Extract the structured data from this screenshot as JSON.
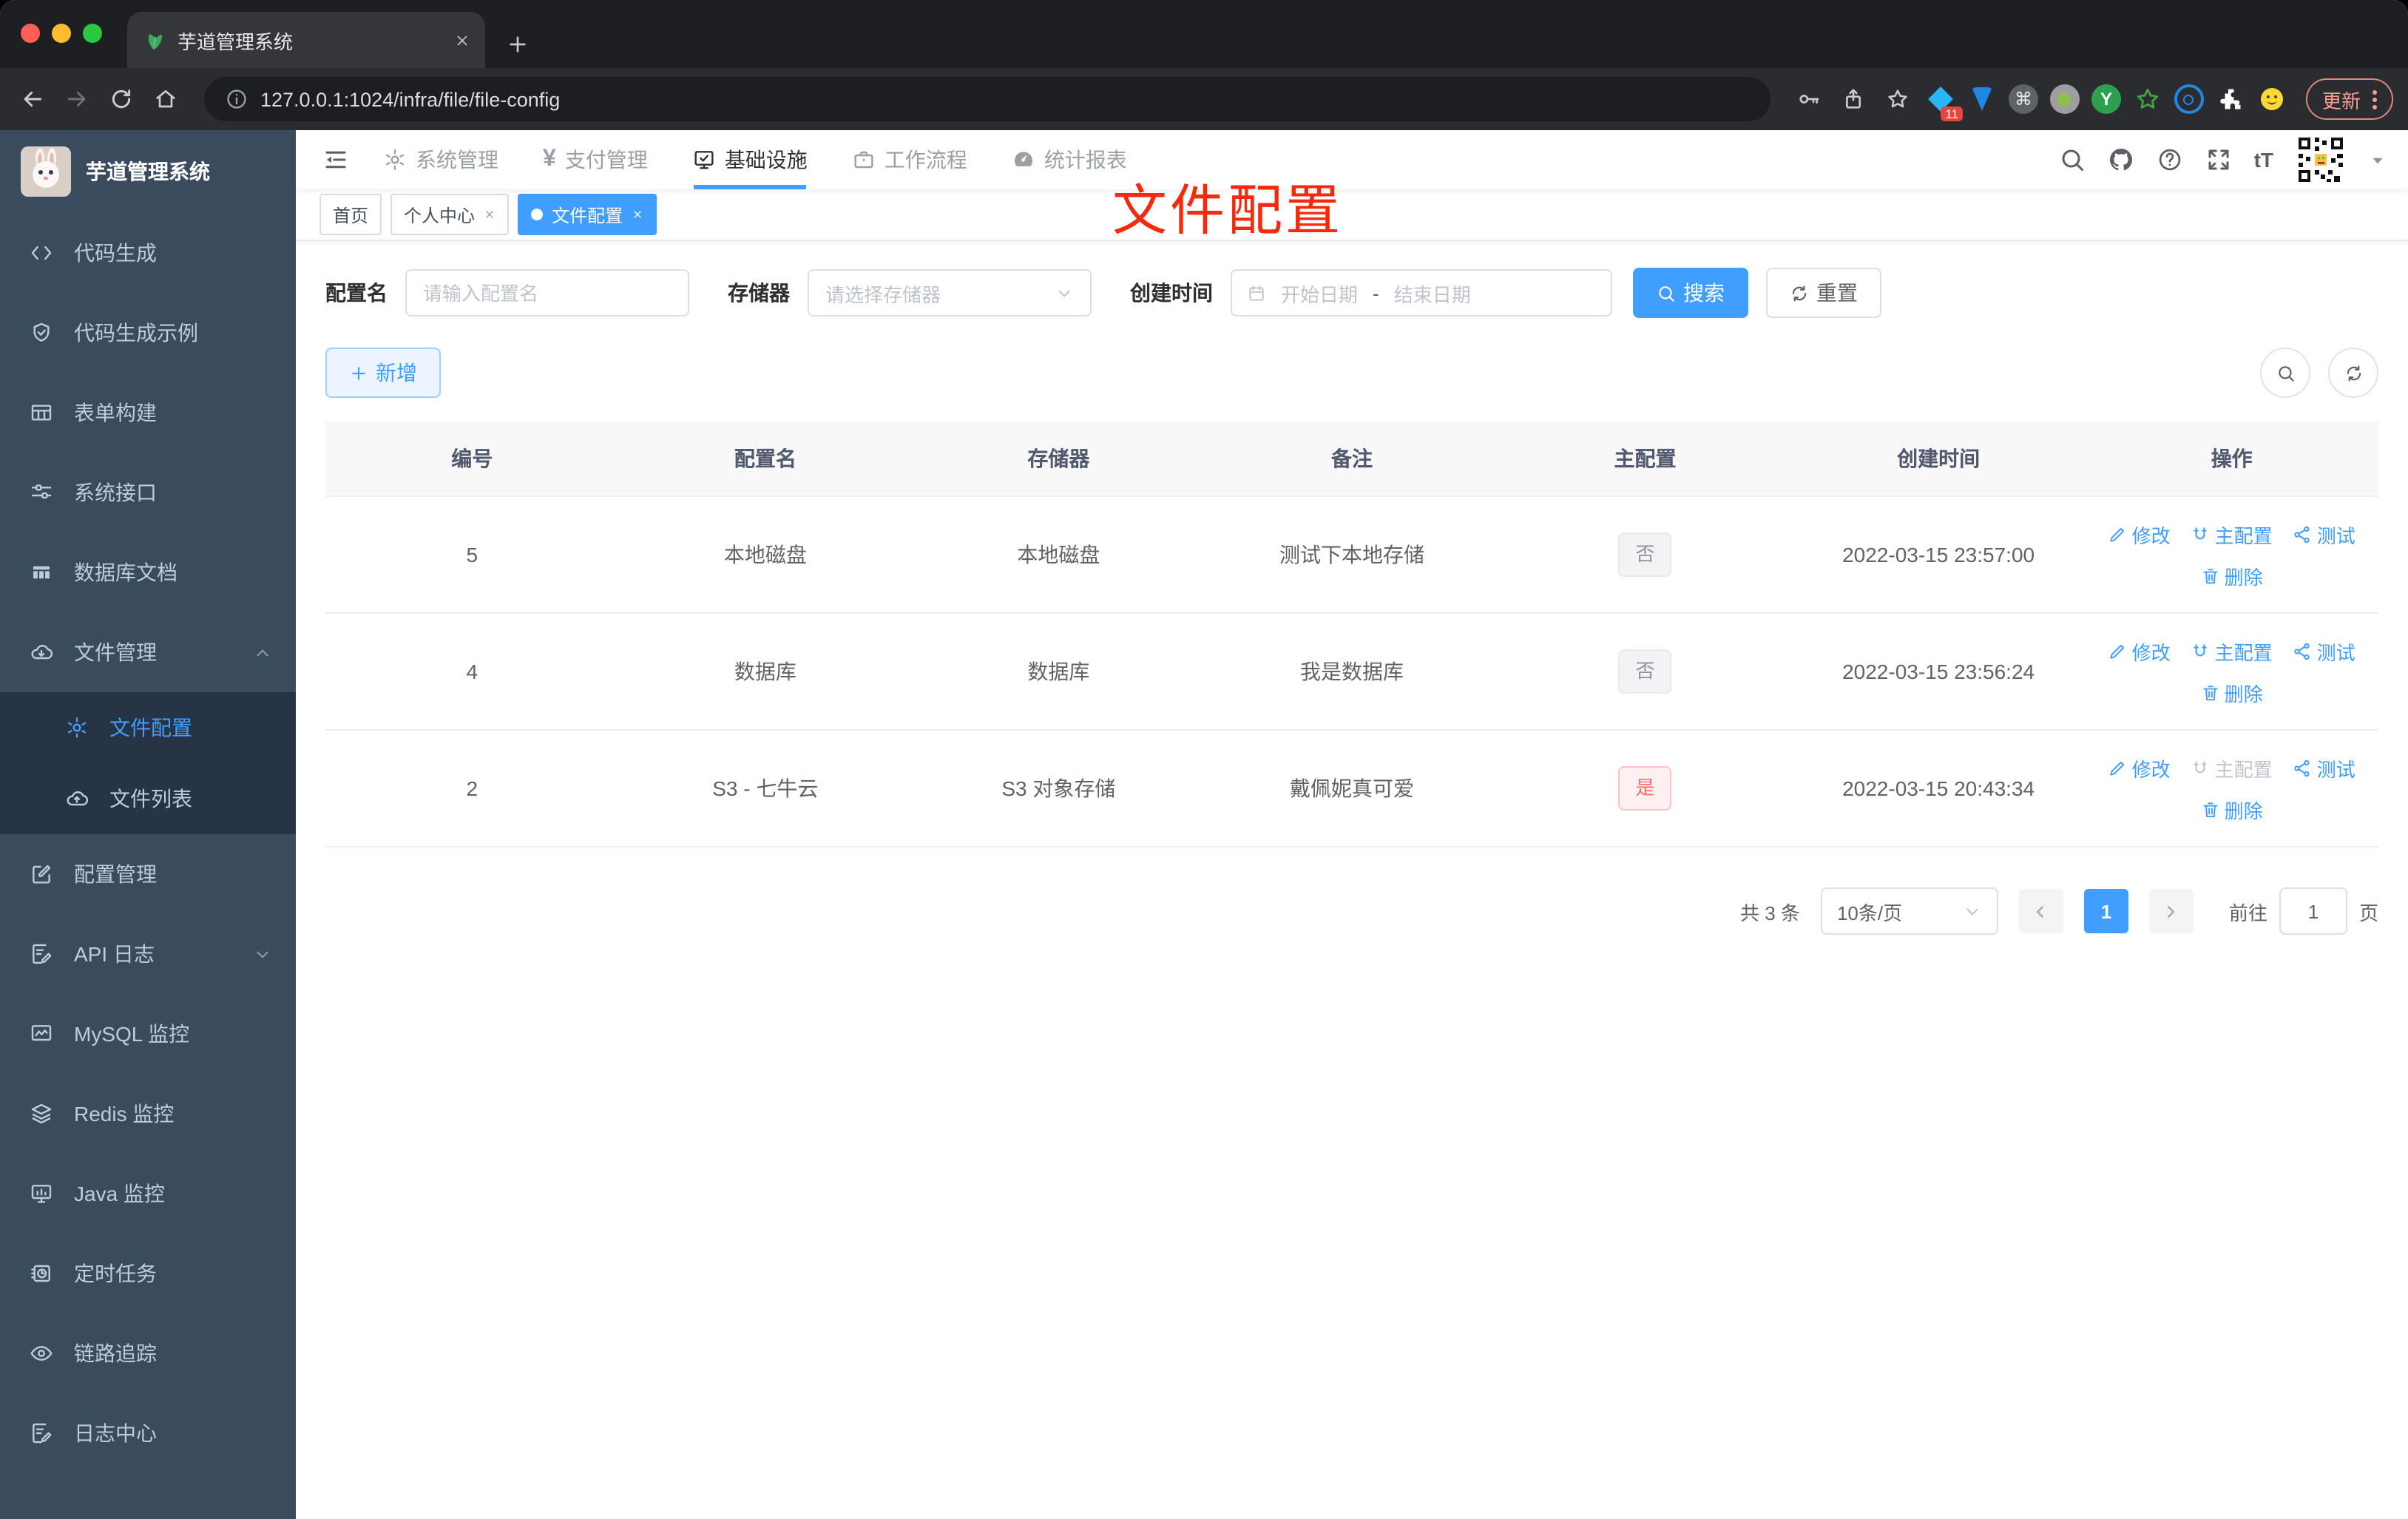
{
  "browser": {
    "tab_title": "芋道管理系统",
    "url": "127.0.0.1:1024/infra/file/file-config",
    "update_label": "更新",
    "extension_badge": "11"
  },
  "glyphs": {
    "command": "⌘",
    "y_logo": "Y",
    "font_size": "tT",
    "yen": "¥"
  },
  "sidebar": {
    "app_title": "芋道管理系统",
    "items": [
      {
        "label": "代码生成"
      },
      {
        "label": "代码生成示例"
      },
      {
        "label": "表单构建"
      },
      {
        "label": "系统接口"
      },
      {
        "label": "数据库文档"
      },
      {
        "label": "文件管理"
      },
      {
        "label": "配置管理"
      },
      {
        "label": "API 日志"
      },
      {
        "label": "MySQL 监控"
      },
      {
        "label": "Redis 监控"
      },
      {
        "label": "Java 监控"
      },
      {
        "label": "定时任务"
      },
      {
        "label": "链路追踪"
      },
      {
        "label": "日志中心"
      }
    ],
    "submenu": [
      {
        "label": "文件配置"
      },
      {
        "label": "文件列表"
      }
    ]
  },
  "topnav": {
    "items": [
      {
        "label": "系统管理"
      },
      {
        "label": "支付管理"
      },
      {
        "label": "基础设施"
      },
      {
        "label": "工作流程"
      },
      {
        "label": "统计报表"
      }
    ]
  },
  "tags": {
    "items": [
      {
        "label": "首页"
      },
      {
        "label": "个人中心"
      },
      {
        "label": "文件配置"
      }
    ]
  },
  "annotation": {
    "text": "文件配置",
    "color": "#f5290c"
  },
  "filters": {
    "config_name_label": "配置名",
    "config_name_placeholder": "请输入配置名",
    "storage_label": "存储器",
    "storage_placeholder": "请选择存储器",
    "created_label": "创建时间",
    "start_placeholder": "开始日期",
    "range_separator": "-",
    "end_placeholder": "结束日期",
    "search_label": "搜索",
    "reset_label": "重置"
  },
  "toolbar": {
    "add_label": "新增"
  },
  "table": {
    "columns": [
      {
        "label": "编号"
      },
      {
        "label": "配置名"
      },
      {
        "label": "存储器"
      },
      {
        "label": "备注"
      },
      {
        "label": "主配置"
      },
      {
        "label": "创建时间"
      },
      {
        "label": "操作"
      }
    ],
    "action_labels": {
      "edit": "修改",
      "master": "主配置",
      "test": "测试",
      "delete": "删除"
    },
    "rows": [
      {
        "id": "5",
        "name": "本地磁盘",
        "storage": "本地磁盘",
        "remark": "测试下本地存储",
        "master": "否",
        "created": "2022-03-15 23:57:00"
      },
      {
        "id": "4",
        "name": "数据库",
        "storage": "数据库",
        "remark": "我是数据库",
        "master": "否",
        "created": "2022-03-15 23:56:24"
      },
      {
        "id": "2",
        "name": "S3 - 七牛云",
        "storage": "S3 对象存储",
        "remark": "戴佩妮真可爱",
        "master": "是",
        "created": "2022-03-15 20:43:34"
      }
    ]
  },
  "pagination": {
    "total": "共 3 条",
    "size": "10条/页",
    "page": "1",
    "goto_label": "前往",
    "goto_value": "1",
    "page_unit": "页"
  },
  "colors": {
    "accent": "#409eff",
    "danger": "#f56c6c",
    "sidebar": "#3a4b5e"
  }
}
